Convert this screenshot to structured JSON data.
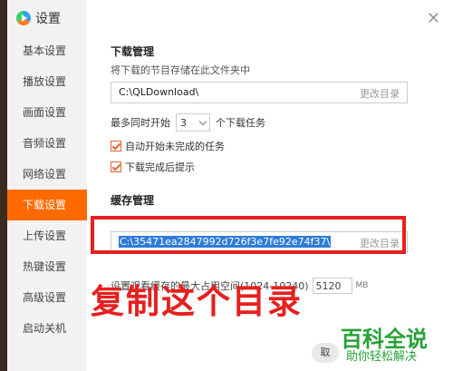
{
  "app": {
    "title": "设置"
  },
  "sidebar": {
    "items": [
      {
        "label": "基本设置",
        "active": false
      },
      {
        "label": "播放设置",
        "active": false
      },
      {
        "label": "画面设置",
        "active": false
      },
      {
        "label": "音频设置",
        "active": false
      },
      {
        "label": "网络设置",
        "active": false
      },
      {
        "label": "下载设置",
        "active": true
      },
      {
        "label": "上传设置",
        "active": false
      },
      {
        "label": "热键设置",
        "active": false
      },
      {
        "label": "高级设置",
        "active": false
      },
      {
        "label": "启动关机",
        "active": false
      }
    ]
  },
  "download": {
    "title": "下载管理",
    "desc": "将下载的节目存储在此文件夹中",
    "path": "C:\\QLDownload\\",
    "change_label": "更改目录",
    "concurrent_prefix": "最多同时开始",
    "concurrent_value": "3",
    "concurrent_suffix": "个下载任务",
    "auto_start_label": "自动开始未完成的任务",
    "auto_start_checked": true,
    "notify_label": "下载完成后提示",
    "notify_checked": true
  },
  "cache": {
    "title": "缓存管理",
    "path": "C:\\35471ea2847992d726f3e7fe92e74f37\\",
    "change_label": "更改目录",
    "size_prefix": "设置观看缓存的最大占用空间(1024-10240)",
    "size_value": "5120",
    "size_unit": "MB"
  },
  "annotation": {
    "text": "复制这个目录",
    "color": "#e5201f"
  },
  "watermark": {
    "title": "百科全说",
    "subtitle": "助你轻松解决"
  },
  "footer": {
    "button_label": "取"
  },
  "colors": {
    "accent": "#ff6a00",
    "checkbox": "#e0662e",
    "selection": "#2f7bd9",
    "watermark": "#26a235"
  }
}
